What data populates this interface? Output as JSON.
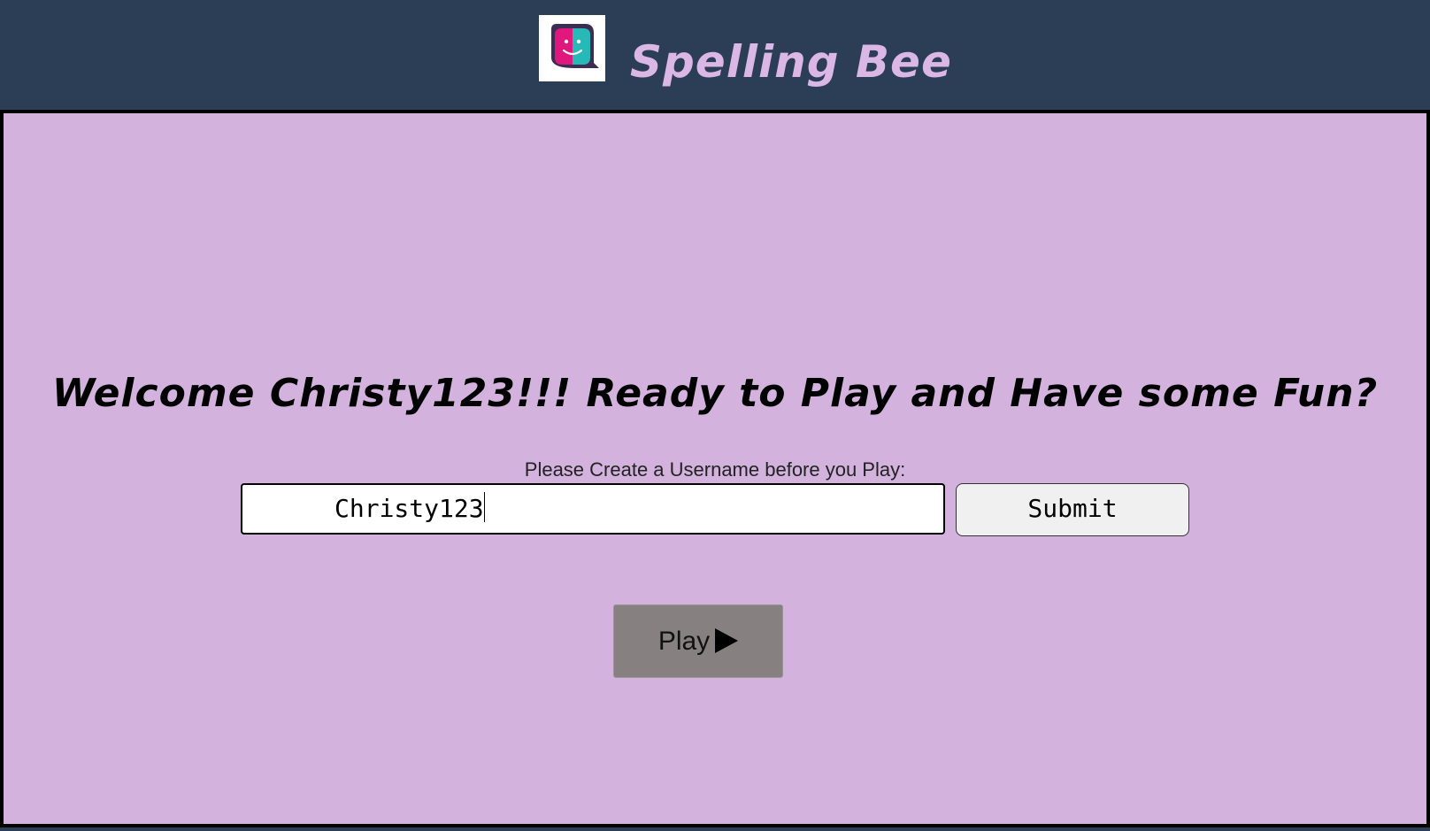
{
  "header": {
    "logo_icon": "chat-faces-logo-icon",
    "title": "Spelling Bee"
  },
  "main": {
    "welcome_text": "Welcome Christy123!!! Ready to Play and Have some Fun?",
    "prompt_text": "Please Create a Username before you Play:",
    "username_value": "Christy123",
    "submit_label": "Submit",
    "play_label": "Play",
    "play_icon": "play-triangle-icon"
  },
  "colors": {
    "header_bg": "#2c3e55",
    "main_bg": "#d3b3de",
    "title_color": "#dbb7e6",
    "play_button_bg": "#878080"
  }
}
